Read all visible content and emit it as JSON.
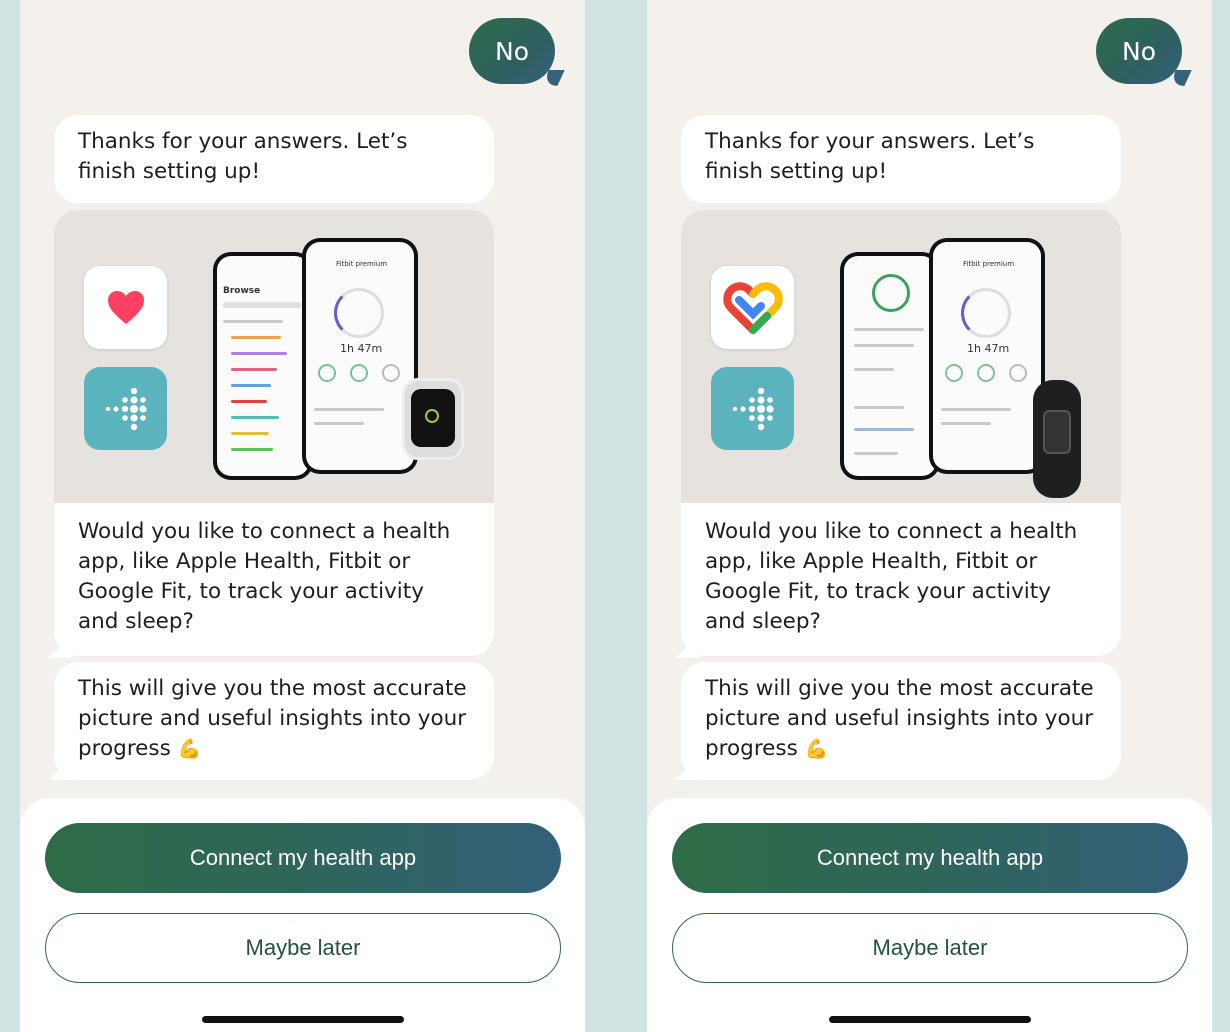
{
  "screens": [
    {
      "user_reply": "No",
      "message_1": "Thanks for your answers. Let’s finish setting up!",
      "message_2": "Would you like to connect a health app, like Apple Health, Fitbit or Google Fit, to track your activity and sleep?",
      "message_3": "This will give you the most accurate picture and useful insights into your progress",
      "message_3_emoji": "💪",
      "primary_button": "Connect my health app",
      "secondary_button": "Maybe later",
      "media": {
        "icons": [
          "apple-health-icon",
          "fitbit-icon"
        ],
        "device": "smartwatch",
        "phone_back_title": "Browse",
        "phone_front_title": "Fitbit premium",
        "phone_front_stat": "1h 47m"
      }
    },
    {
      "user_reply": "No",
      "message_1": "Thanks for your answers. Let’s finish setting up!",
      "message_2": "Would you like to connect a health app, like Apple Health, Fitbit or Google Fit, to track your activity and sleep?",
      "message_3": "This will give you the most accurate picture and useful insights into your progress",
      "message_3_emoji": "💪",
      "primary_button": "Connect my health app",
      "secondary_button": "Maybe later",
      "media": {
        "icons": [
          "google-fit-icon",
          "fitbit-icon"
        ],
        "device": "fitness-band",
        "phone_back_title": "",
        "phone_front_title": "Fitbit premium",
        "phone_front_stat": "1h 47m"
      }
    }
  ],
  "colors": {
    "background": "#cfe4e2",
    "screen": "#f4f1ed",
    "accent_green": "#2e6c47",
    "accent_teal": "#33607a",
    "fitbit": "#5ab3bd"
  }
}
